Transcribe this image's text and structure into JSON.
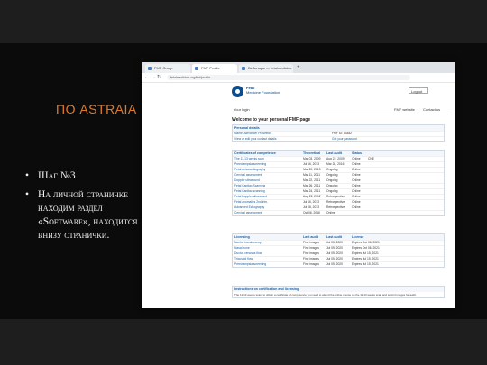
{
  "slide": {
    "title": "ПО ASTRAIA",
    "bullets": [
      "Шаг №3",
      "На личной страничке находим раздел «Software», находится внизу странички."
    ]
  },
  "browser": {
    "tabs": [
      {
        "label": "FMF Group",
        "active": false
      },
      {
        "label": "FMF Profile",
        "active": true
      },
      {
        "label": "Вебинары — fetalmedicine",
        "active": false
      }
    ],
    "new_tab": "+",
    "url": "fetalmedicine.org/fmf/profile"
  },
  "page": {
    "brand_line1": "Fetal",
    "brand_line2": "Medicine Foundation",
    "language": "Logout",
    "menu_left": "Your login",
    "menu_right": [
      "FMF website",
      "Contact us"
    ],
    "welcome": "Welcome to your personal FMF page",
    "personal": {
      "header": "Personal details",
      "rows": [
        [
          "Name: Alexander Prosvetov",
          "FMF ID: 53482"
        ],
        [
          "View or edit your contact details",
          "Get your password"
        ]
      ]
    },
    "certificates": {
      "header": "Certificates of competence",
      "cols": [
        "Theoretical",
        "Last audit",
        "Status"
      ],
      "rows": [
        [
          "The 11-13 weeks scan",
          "Mar 03, 2009",
          "Aug 22, 2009",
          "Online",
          "CNE"
        ],
        [
          "Preeclampsia screening",
          "Jul 16, 2013",
          "Mar 28, 2016",
          "Online"
        ],
        [
          "Fetal echocardiography",
          "Mar 20, 2013",
          "Ongoing",
          "Online"
        ],
        [
          "Cervical assessment",
          "Mar 11, 2011",
          "Ongoing",
          "Online"
        ],
        [
          "Doppler ultrasound",
          "Mar 22, 2011",
          "Ongoing",
          "Online"
        ],
        [
          "Fetal Cardiac Scanning",
          "Mar 26, 2011",
          "Ongoing",
          "Online"
        ],
        [
          "Fetal Cardiac scanning",
          "Mar 24, 2011",
          "Ongoing",
          "Online"
        ],
        [
          "Fetal Doppler ultrasound",
          "Aug 22, 2012",
          "Retrospective",
          "Online"
        ],
        [
          "Fetal anomalies 2nd trim.",
          "Jul 16, 2013",
          "Retrospective",
          "Online"
        ],
        [
          "Advanced Echography",
          "Jul 08, 2013",
          "Retrospective",
          "Online"
        ],
        [
          "Cervical assessment",
          "Oct 06, 2016",
          "Online"
        ]
      ]
    },
    "licensing": {
      "header": "Licensing",
      "cols": [
        "Last audit",
        "Last audit",
        "License"
      ],
      "rows": [
        [
          "Nuchal translucency",
          "Fine images",
          "Jul 05, 2020",
          "Expires Oct 06, 2021"
        ],
        [
          "Nasal bone",
          "Fine images",
          "Jul 05, 2020",
          "Expires Oct 06, 2021"
        ],
        [
          "Ductus venosus flow",
          "Fine images",
          "Jul 05, 2020",
          "Expires Jul 15, 2021"
        ],
        [
          "Tricuspid flow",
          "Fine images",
          "Jul 05, 2020",
          "Expires Jul 15, 2021"
        ],
        [
          "Preeclampsia screening",
          "Fine images",
          "Jul 05, 2020",
          "Expires Jul 15, 2021"
        ]
      ]
    },
    "instructions": {
      "header": "Instructions on certification and licensing",
      "text": "The 11-13 weeks scan: to obtain a certificate of competence you need to attend the online course on the 11-13 weeks scan and submit images for audit."
    }
  },
  "colors": {
    "title": "#e07a2a",
    "link": "#1b5fa6",
    "logo": "#0e4c8a"
  }
}
